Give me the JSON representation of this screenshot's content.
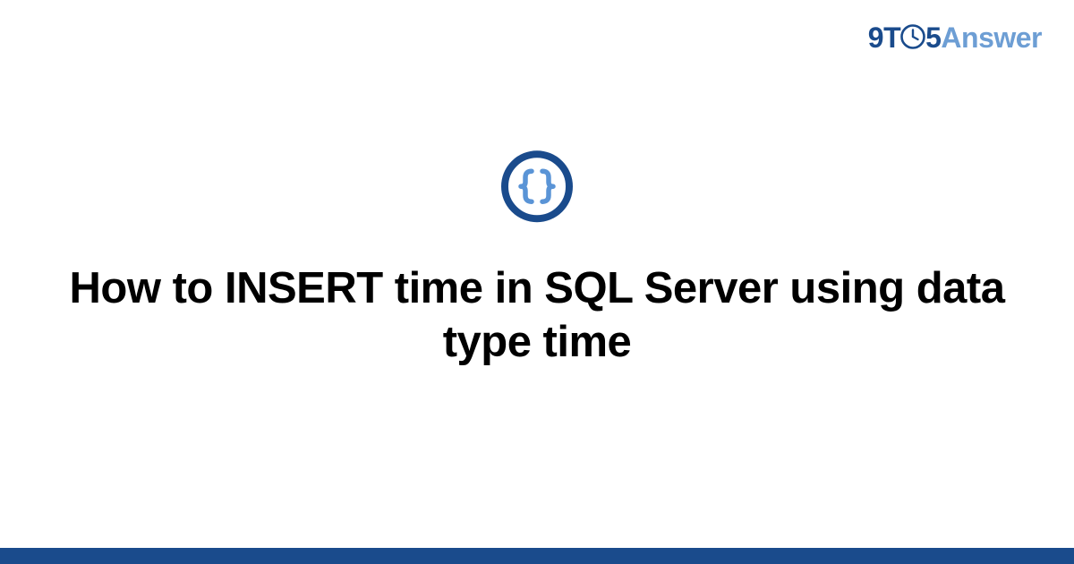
{
  "logo": {
    "prefix": "9T",
    "mid": "5",
    "suffix": "Answer"
  },
  "badge": {
    "icon_name": "braces-icon",
    "ring_color": "#1a4b8c",
    "glyph_color": "#5a94d6"
  },
  "title": "How to INSERT time in SQL Server using data type time",
  "colors": {
    "footer": "#1a4b8c"
  }
}
